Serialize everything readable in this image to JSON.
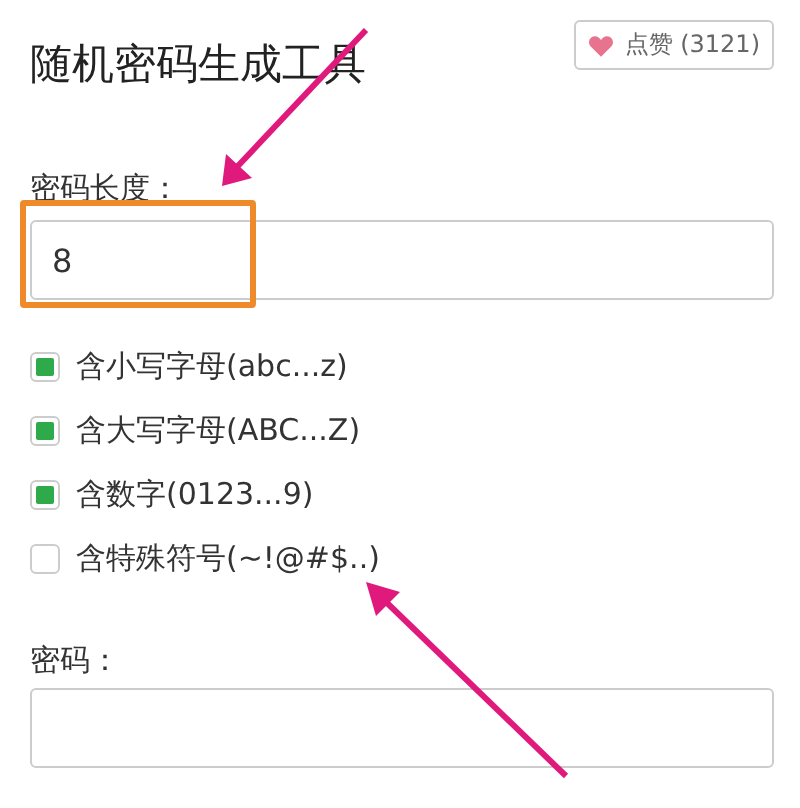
{
  "title": "随机密码生成工具",
  "like_button": {
    "label": "点赞 (3121)"
  },
  "length_field": {
    "label": "密码长度：",
    "value": "8"
  },
  "options": [
    {
      "label": "含小写字母(abc...z)",
      "checked": true
    },
    {
      "label": "含大写字母(ABC...Z)",
      "checked": true
    },
    {
      "label": "含数字(0123...9)",
      "checked": true
    },
    {
      "label": "含特殊符号(~!@#$..)",
      "checked": false
    }
  ],
  "password_field": {
    "label": "密码："
  }
}
